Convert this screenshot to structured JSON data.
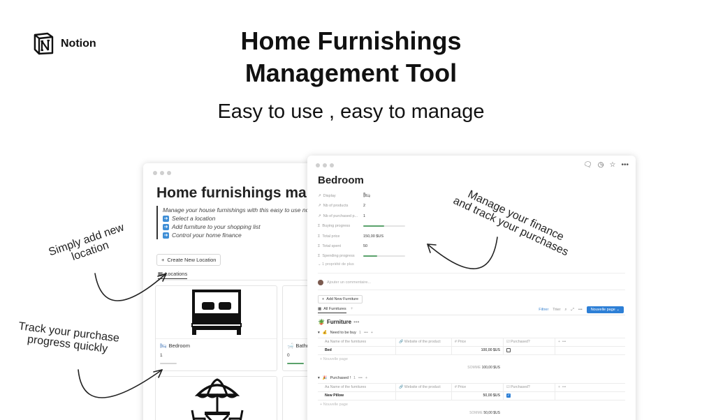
{
  "brand": {
    "name": "Notion"
  },
  "hero": {
    "title_line1": "Home Furnishings",
    "title_line2": "Management Tool",
    "subtitle": "Easy to use , easy to manage"
  },
  "annotations": {
    "add_location": {
      "line1": "Simply add new",
      "line2": "location"
    },
    "track_progress": {
      "line1": "Track your purchase",
      "line2": "progress quickly"
    },
    "finance": {
      "line1": "Manage your finance",
      "line2": "and track your purchases"
    }
  },
  "left_window": {
    "title": "Home furnishings man",
    "callout_intro": "Manage your house furnishings with this easy to use notion",
    "callout_items": [
      "Select a location",
      "Add furniture to your shopping list",
      "Control your home finance"
    ],
    "create_button": "Create New Location",
    "tab_label": "Locations",
    "cards": [
      {
        "name": "Bedroom",
        "count": "1"
      },
      {
        "name": "Bathro",
        "count": "0"
      }
    ]
  },
  "right_window": {
    "title": "Bedroom",
    "properties": [
      {
        "key": "Display",
        "value": ""
      },
      {
        "key": "Nb of products",
        "value": "2"
      },
      {
        "key": "Nb of purchased p...",
        "value": "1"
      },
      {
        "key": "Buying progress",
        "value": "",
        "progress": 0.5
      },
      {
        "key": "Total price",
        "value": "150,00 $US"
      },
      {
        "key": "Total spent",
        "value": "50"
      },
      {
        "key": "Spending progress",
        "value": "",
        "progress": 0.33
      }
    ],
    "more_properties": "1 propriété de plus",
    "comment_placeholder": "Ajouter un commentaire...",
    "add_button": "Add New Furniture",
    "view_tab": "All Furnitures",
    "toolbar": {
      "filter": "Filtrer",
      "sort": "Trier",
      "new_page": "Nouvelle page"
    },
    "database_title": "Furniture",
    "columns": [
      "Name of the furnitures",
      "Website of the product",
      "Price",
      "Purchased?"
    ],
    "groups": [
      {
        "label": "Need to be buy",
        "count": "1",
        "rows": [
          {
            "name": "Bed",
            "website": "",
            "price": "100,00 $US",
            "purchased": false
          }
        ],
        "new_row": "Nouvelle page",
        "sum_label": "SOMME",
        "sum_value": "100,00 $US"
      },
      {
        "label": "Purchased !",
        "count": "1",
        "rows": [
          {
            "name": "New Pillow",
            "website": "",
            "price": "50,00 $US",
            "purchased": true
          }
        ],
        "new_row": "Nouvelle page",
        "sum_label": "SOMME",
        "sum_value": "50,00 $US"
      }
    ]
  }
}
